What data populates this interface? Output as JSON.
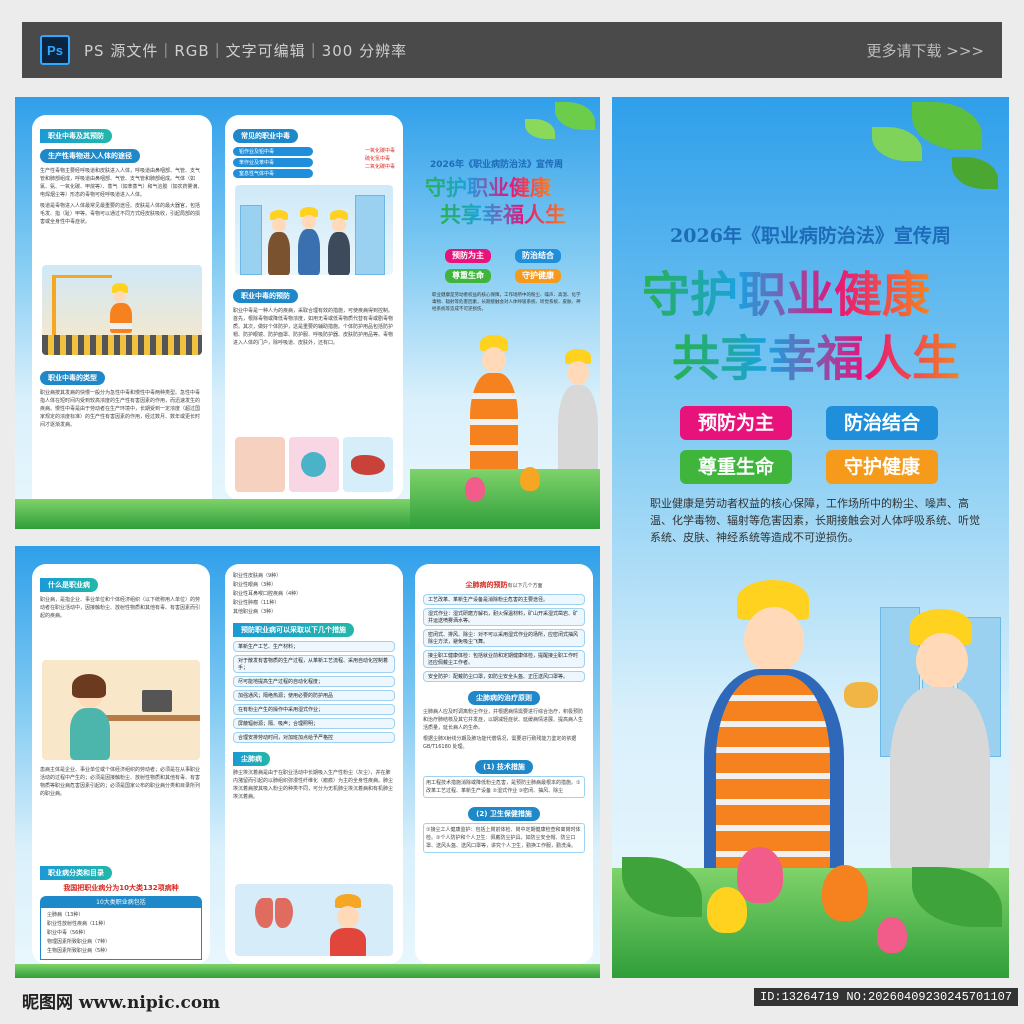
{
  "topbar": {
    "logo": "Ps",
    "info": "PS 源文件｜RGB｜文字可编辑｜300 分辨率",
    "more": "更多请下载 >>>"
  },
  "poster": {
    "week_title": "2026年《职业病防治法》宣传周",
    "slogan_line1": "守护职业健康",
    "slogan_line2": "共享幸福人生",
    "tags": [
      "预防为主",
      "防治结合",
      "尊重生命",
      "守护健康"
    ],
    "description": "职业健康是劳动者权益的核心保障，工作场所中的粉尘、噪声、高温、化学毒物、辐射等危害因素，长期接触会对人体呼吸系统、听觉系统、皮肤、神经系统等造成不可逆损伤。"
  },
  "panel_tl": {
    "header": "职业中毒及其预防",
    "sec1": "生产性毒物进入人体的途径",
    "sec1_text": "生产性毒物主要经呼吸道和皮肤进入人体，呼吸道由鼻咽部、气管、支气管和肺部组成，呼吸道由鼻咽部、气管、支气管和肺部组成。气体（如氯、氨、一氧化碳、甲烷等）、蒸气（如苯蒸气）和气溶胶（如农药雾滴、电焊烟尘等）形态的毒物可经呼吸道进入人体。",
    "sec1_text2": "吸道是毒物进入人体最常见最重要的途径。皮肤是人体的最大器官，包括毛发、指（趾）甲等。毒物可以通过不同方式经皮肤吸收，引起局部的损害或全身性中毒症状。",
    "sec2": "职业中毒的类型",
    "sec2_text": "职业病按其发病的快慢一般分为急性中毒和慢性中毒两种类型。急性中毒指人体在短时间内受到较高浓度的生产性有害因素的作用，而迅速发生的疾病。慢性中毒是由于劳动者在生产环境中，长期受到一定浓度（超过国家规定的浓度标准）的生产性有害因素的作用，经过数月、数年或更长时间才逐渐发病。"
  },
  "panel_tm": {
    "sec1": "常见的职业中毒",
    "items_left": [
      "铅作业及铅中毒",
      "苯作业及苯中毒",
      "窒息性气体中毒"
    ],
    "items_right": [
      "一氧化碳中毒",
      "硫化氢中毒",
      "二氧化碳中毒"
    ],
    "sec2": "职业中毒的预防",
    "sec2_text": "职业中毒是一种人为的疾病，采取合理有效的措施，可使疾病得到控制。首先，根除毒物或降低毒物浓度，如用无毒或低毒物质代替有毒或剧毒物质。其次，做好个体防护，这是重要的辅助措施。个体防护用品包括防护帽、防护眼镜、防护面罩、防护服、呼吸防护器、皮肤防护用品等。毒物进入人体的门户，除呼吸道、皮肤外，还有口。"
  },
  "panel_tr_small": {
    "week_title": "2026年《职业病防治法》宣传周",
    "slogan_line1": "守护职业健康",
    "slogan_line2": "共享幸福人生",
    "tags": [
      "预防为主",
      "防治结合",
      "尊重生命",
      "守护健康"
    ],
    "description": "职业健康是劳动者权益的核心保障，工作场所中的粉尘、噪声、高温、化学毒物、辐射等危害因素，长期接触会对人体呼吸系统、听觉系统、皮肤、神经系统等造成不可逆损伤。"
  },
  "panel_bl": {
    "sec1": "什么是职业病",
    "sec1_text": "职业病，是指企业、事业单位和个体经济组织（以下统称用人单位）的劳动者在职业活动中，因接触粉尘、放射性物质和其他有毒、有害因素而引起的疾病。",
    "sec1_text2": "患病主体是企业、事业单位或个体经济组织的劳动者；必须是在从事职业活动的过程中产生的；必须是因接触粉尘、放射性物质和其他有毒、有害物质等职业病危害因素引起的；必须是国家公布的职业病分类和目录所列的职业病。",
    "sec2": "职业病分类和目录",
    "sec2_red": "我国把职业病分为10大类132项病种",
    "sec2_box": "10大类职业病包括",
    "list": [
      "尘肺病（13种）",
      "职业性放射性疾病（11种）",
      "职业中毒（56种）",
      "物理因素所致职业病（7种）",
      "生物因素所致职业病（5种）"
    ]
  },
  "panel_bm": {
    "list_top": [
      "职业性皮肤病（9种）",
      "职业性眼病（3种）",
      "职业性耳鼻喉口腔疾病（4种）",
      "职业性肿瘤（11种）",
      "其他职业病（3种）"
    ],
    "sec1": "预防职业病可以采取以下几个措施",
    "measures": [
      "革新生产工艺、生产材料；",
      "对于散发有害物质的生产过程，从革新工艺流程、采用自动化控制着手；",
      "尽可能地提高生产过程的自动化程度；",
      "加强通风；隔绝热源；使用必要的防护用品",
      "在有粉尘产生的操作中采用湿式作业；",
      "屏蔽辐射源；隔、吸声；合理照明；",
      "合理安排劳动时间，对加班加点给予严格控"
    ],
    "sec2": "尘肺病",
    "sec2_text": "肺尘埃沉着病是由于在职业活动中长期吸入生产性粉尘（灰尘），并在肺内潴留而引起的以肺组织弥漫性纤维化（瘢痕）为主的全身性疾病。肺尘埃沉着病按其吸入粉尘的种类不同，可分为无机肺尘埃沉着病和有机肺尘埃沉着病。"
  },
  "panel_br": {
    "title": "尘肺病的预防",
    "title_suffix": "有以下几个方面",
    "measures": [
      "工艺改革、革新生产设备是消除粉尘危害的主要途径。",
      "湿式作业：湿式研磨方解石，耐火保温材料，矿山开采湿式凿岩、矿井运送喷雾洒水等。",
      "密闭式、排风、除尘：对不可以采用湿式作业的场所，应密闭式抽风除尘方法，避免吸尘飞舞。",
      "接尘职工健康体检：包括就业前和定期健康体检，提醒接尘职工作时还应佩戴尘工作者。",
      "安全防护：配戴防尘口罩，如防尘安全头盔、正压送风口罩等。"
    ],
    "sec2": "尘肺病的治疗原则",
    "treat_text": "尘肺病人应及时调离粉尘作业，并根据病情需要进行综合治疗，积极预防和治疗肺结核及其它并发症，以期减轻症状、延缓病情进展、提高病人生活质量，延长病人的生命。",
    "diag_text": "根据尘肺X射线分期及肺功能代偿情况，需要进行致残能力鉴定的依据 GB/T16180 处理。",
    "sub1": "(1) 技术措施",
    "sub1_text": "用工程技术措施消除或降低粉尘危害，是预防尘肺病最根本的措施。①改革工艺过程、革新生产设备 ②湿式作业 ③密闭、抽风、除尘",
    "sub2": "(2) 卫生保健措施",
    "sub2_text": "①接尘工人健康监护：包括上岗前体检、岗中定期健康检查和离岗时体检。②个人防护和个人卫生：佩戴防尘护具，如防尘安全帽、防尘口罩、送风头盔、送风口罩等，讲究个人卫生，勤换工作服，勤洗澡。"
  },
  "footer": {
    "left": "昵图网 www.nipic.com",
    "right": "ID:13264719 NO:20260409230245701107"
  },
  "colors": {
    "pink": "#e8137a",
    "blue": "#1f8fdc",
    "green": "#3fb63b",
    "orange": "#f59a1a"
  }
}
